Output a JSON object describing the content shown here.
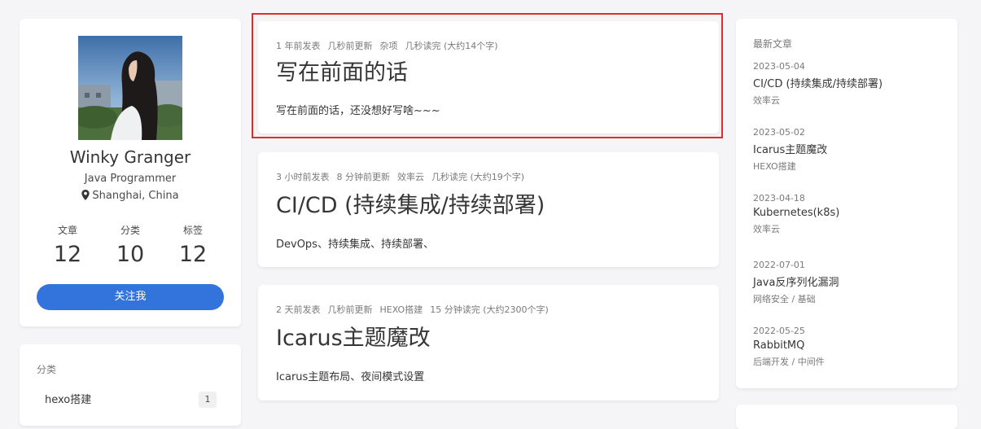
{
  "profile": {
    "name": "Winky Granger",
    "role": "Java Programmer",
    "location": "Shanghai, China",
    "stats": [
      {
        "label": "文章",
        "value": "12"
      },
      {
        "label": "分类",
        "value": "10"
      },
      {
        "label": "标签",
        "value": "12"
      }
    ],
    "follow_label": "关注我"
  },
  "categories": {
    "heading": "分类",
    "items": [
      {
        "name": "hexo搭建",
        "count": "1"
      }
    ]
  },
  "posts": [
    {
      "meta": [
        "1 年前发表",
        "几秒前更新",
        "杂项",
        "几秒读完 (大约14个字)"
      ],
      "title": "写在前面的话",
      "excerpt": "写在前面的话，还没想好写啥~~~"
    },
    {
      "meta": [
        "3 小时前发表",
        "8 分钟前更新",
        "效率云",
        "几秒读完 (大约19个字)"
      ],
      "title": "CI/CD (持续集成/持续部署)",
      "excerpt": "DevOps、持续集成、持续部署、"
    },
    {
      "meta": [
        "2 天前发表",
        "几秒前更新",
        "HEXO搭建",
        "15 分钟读完 (大约2300个字)"
      ],
      "title": "Icarus主题魔改",
      "excerpt": "Icarus主题布局、夜间模式设置"
    }
  ],
  "recent": {
    "heading": "最新文章",
    "items": [
      {
        "date": "2023-05-04",
        "title": "CI/CD (持续集成/持续部署)",
        "category": "效率云"
      },
      {
        "date": "2023-05-02",
        "title": "Icarus主题魔改",
        "category": "HEXO搭建"
      },
      {
        "date": "2023-04-18",
        "title": "Kubernetes(k8s)",
        "category": "效率云"
      },
      {
        "date": "2022-07-01",
        "title": "Java反序列化漏洞",
        "category": "网络安全 / 基础"
      },
      {
        "date": "2022-05-25",
        "title": "RabbitMQ",
        "category": "后端开发 / 中间件"
      }
    ]
  },
  "colors": {
    "accent": "#3273dc",
    "highlight": "#e22c2c"
  }
}
